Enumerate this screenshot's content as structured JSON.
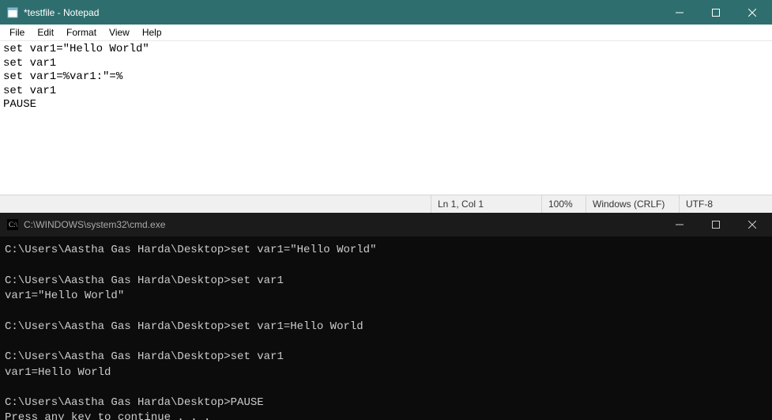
{
  "notepad": {
    "title": "*testfile - Notepad",
    "menu": {
      "file": "File",
      "edit": "Edit",
      "format": "Format",
      "view": "View",
      "help": "Help"
    },
    "content": "set var1=\"Hello World\"\nset var1\nset var1=%var1:\"=%\nset var1\nPAUSE",
    "status": {
      "pos": "Ln 1, Col 1",
      "zoom": "100%",
      "eol": "Windows (CRLF)",
      "enc": "UTF-8"
    }
  },
  "cmd": {
    "title": "C:\\WINDOWS\\system32\\cmd.exe",
    "output": "C:\\Users\\Aastha Gas Harda\\Desktop>set var1=\"Hello World\"\n\nC:\\Users\\Aastha Gas Harda\\Desktop>set var1\nvar1=\"Hello World\"\n\nC:\\Users\\Aastha Gas Harda\\Desktop>set var1=Hello World\n\nC:\\Users\\Aastha Gas Harda\\Desktop>set var1\nvar1=Hello World\n\nC:\\Users\\Aastha Gas Harda\\Desktop>PAUSE\nPress any key to continue . . ."
  }
}
